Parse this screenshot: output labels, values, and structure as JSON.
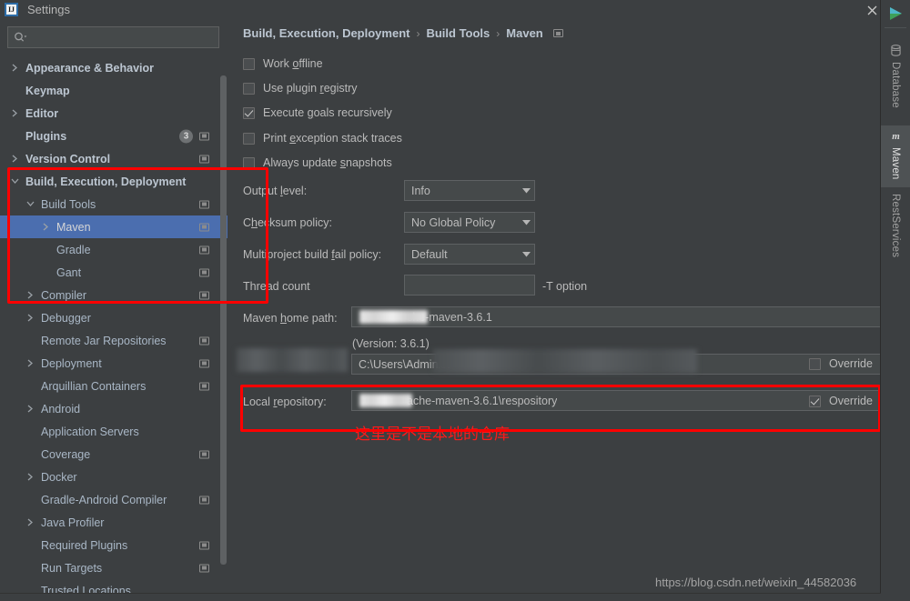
{
  "window": {
    "title": "Settings",
    "logo_text": "IJ",
    "close_label": "×"
  },
  "search": {
    "value": "",
    "placeholder": ""
  },
  "sidebar": {
    "items": [
      {
        "label": "Appearance & Behavior",
        "indent": 0,
        "arrow": "right",
        "bold": true,
        "icon": false,
        "badge": ""
      },
      {
        "label": "Keymap",
        "indent": 0,
        "arrow": "none",
        "bold": true,
        "icon": false,
        "badge": ""
      },
      {
        "label": "Editor",
        "indent": 0,
        "arrow": "right",
        "bold": true,
        "icon": false,
        "badge": ""
      },
      {
        "label": "Plugins",
        "indent": 0,
        "arrow": "none",
        "bold": true,
        "icon": true,
        "badge": "3"
      },
      {
        "label": "Version Control",
        "indent": 0,
        "arrow": "right",
        "bold": true,
        "icon": true,
        "badge": ""
      },
      {
        "label": "Build, Execution, Deployment",
        "indent": 0,
        "arrow": "down",
        "bold": true,
        "icon": false,
        "badge": ""
      },
      {
        "label": "Build Tools",
        "indent": 1,
        "arrow": "down",
        "bold": false,
        "icon": true,
        "badge": ""
      },
      {
        "label": "Maven",
        "indent": 2,
        "arrow": "right",
        "bold": false,
        "icon": true,
        "badge": "",
        "selected": true
      },
      {
        "label": "Gradle",
        "indent": 2,
        "arrow": "none",
        "bold": false,
        "icon": true,
        "badge": ""
      },
      {
        "label": "Gant",
        "indent": 2,
        "arrow": "none",
        "bold": false,
        "icon": true,
        "badge": ""
      },
      {
        "label": "Compiler",
        "indent": 1,
        "arrow": "right",
        "bold": false,
        "icon": true,
        "badge": ""
      },
      {
        "label": "Debugger",
        "indent": 1,
        "arrow": "right",
        "bold": false,
        "icon": false,
        "badge": ""
      },
      {
        "label": "Remote Jar Repositories",
        "indent": 1,
        "arrow": "none",
        "bold": false,
        "icon": true,
        "badge": ""
      },
      {
        "label": "Deployment",
        "indent": 1,
        "arrow": "right",
        "bold": false,
        "icon": true,
        "badge": ""
      },
      {
        "label": "Arquillian Containers",
        "indent": 1,
        "arrow": "none",
        "bold": false,
        "icon": true,
        "badge": ""
      },
      {
        "label": "Android",
        "indent": 1,
        "arrow": "right",
        "bold": false,
        "icon": false,
        "badge": ""
      },
      {
        "label": "Application Servers",
        "indent": 1,
        "arrow": "none",
        "bold": false,
        "icon": false,
        "badge": ""
      },
      {
        "label": "Coverage",
        "indent": 1,
        "arrow": "none",
        "bold": false,
        "icon": true,
        "badge": ""
      },
      {
        "label": "Docker",
        "indent": 1,
        "arrow": "right",
        "bold": false,
        "icon": false,
        "badge": ""
      },
      {
        "label": "Gradle-Android Compiler",
        "indent": 1,
        "arrow": "none",
        "bold": false,
        "icon": true,
        "badge": ""
      },
      {
        "label": "Java Profiler",
        "indent": 1,
        "arrow": "right",
        "bold": false,
        "icon": false,
        "badge": ""
      },
      {
        "label": "Required Plugins",
        "indent": 1,
        "arrow": "none",
        "bold": false,
        "icon": true,
        "badge": ""
      },
      {
        "label": "Run Targets",
        "indent": 1,
        "arrow": "none",
        "bold": false,
        "icon": true,
        "badge": ""
      },
      {
        "label": "Trusted Locations",
        "indent": 1,
        "arrow": "none",
        "bold": false,
        "icon": false,
        "badge": ""
      }
    ]
  },
  "breadcrumb": {
    "crumb1": "Build, Execution, Deployment",
    "crumb2": "Build Tools",
    "crumb3": "Maven",
    "separator": "›"
  },
  "maven": {
    "checkboxes": [
      {
        "pre": "Work ",
        "mn": "o",
        "post": "ffline",
        "checked": false
      },
      {
        "pre": "Use plugin ",
        "mn": "r",
        "post": "egistry",
        "checked": false
      },
      {
        "pre": "Execute ",
        "mn": "g",
        "post": "oals recursively",
        "checked": true
      },
      {
        "pre": "Print ",
        "mn": "e",
        "post": "xception stack traces",
        "checked": false
      },
      {
        "pre": "Always update ",
        "mn": "s",
        "post": "napshots",
        "checked": false
      }
    ],
    "output_level": {
      "pre": "Output ",
      "mn": "l",
      "post": "evel:",
      "value": "Info"
    },
    "checksum_policy": {
      "pre": "C",
      "mn": "h",
      "post": "ecksum policy:",
      "value": "No Global Policy"
    },
    "multiproject_policy": {
      "pre": "Multiproject build ",
      "mn": "f",
      "post": "ail policy:",
      "value": "Default"
    },
    "thread_count": {
      "pre": "Thread count",
      "mn": "",
      "post": "",
      "value": "",
      "hint": "-T option"
    },
    "home_path": {
      "pre": "Maven ",
      "mn": "h",
      "post": "ome path:",
      "value": "che-maven-3.6.1",
      "ellipsis": "…"
    },
    "version_note": "(Version: 3.6.1)",
    "user_settings": {
      "label": "User settings file:",
      "value": "C:\\Users\\Administ",
      "override_label": "Override",
      "override_checked": false
    },
    "local_repository": {
      "pre": "Local ",
      "mn": "r",
      "post": "epository:",
      "value": "ache-maven-3.6.1\\respository",
      "override_label": "Override",
      "override_checked": true
    }
  },
  "annotation": {
    "note_text": "这里是不是本地的仓库",
    "color": "#ff0000"
  },
  "toolstrip": {
    "items": [
      {
        "label": "Database",
        "icon": "database-icon",
        "active": false
      },
      {
        "label": "Maven",
        "icon": "maven-icon",
        "active": true
      },
      {
        "label": "RestServices",
        "icon": "",
        "active": false
      }
    ]
  },
  "watermark": {
    "text": "https://blog.csdn.net/weixin_44582036"
  },
  "colors": {
    "background": "#3c3f41",
    "selection": "#4b6eaf",
    "field": "#45494a",
    "text": "#bbbbbb",
    "accent_red": "#ff0000"
  }
}
